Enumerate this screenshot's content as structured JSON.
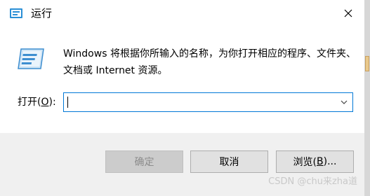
{
  "window": {
    "title": "运行",
    "close_icon": "close-icon"
  },
  "content": {
    "description": "Windows 将根据你所输入的名称，为你打开相应的程序、文件夹、文档或 Internet 资源。",
    "open_label_prefix": "打开(",
    "open_label_key": "O",
    "open_label_suffix": "):",
    "input_value": ""
  },
  "buttons": {
    "ok": "确定",
    "cancel": "取消",
    "browse_prefix": "浏览(",
    "browse_key": "B",
    "browse_suffix": ")..."
  },
  "watermark": "CSDN @chu来zha道",
  "colors": {
    "focus_border": "#0078d7",
    "window_bg": "#f0f0f0"
  }
}
